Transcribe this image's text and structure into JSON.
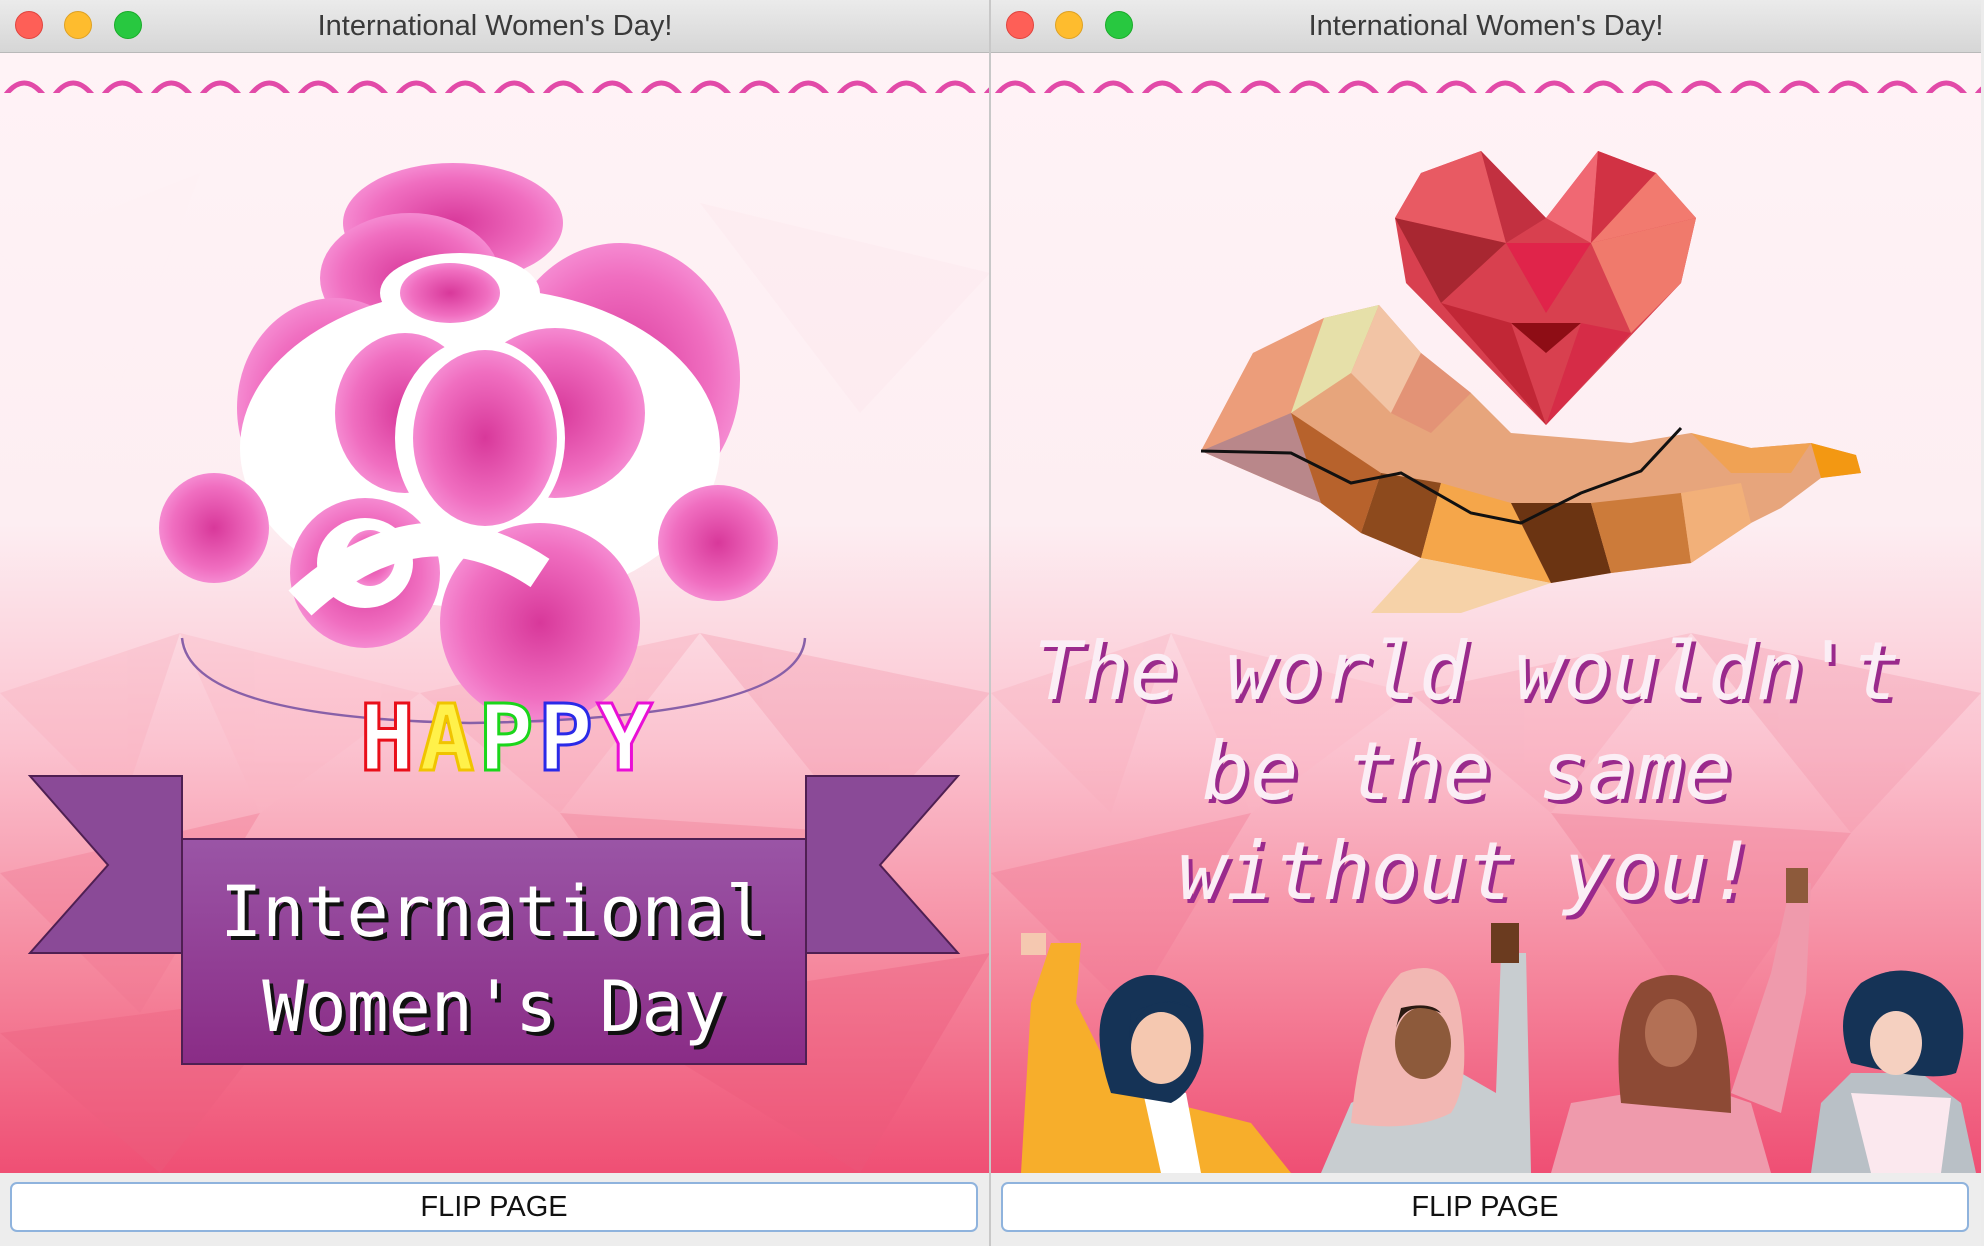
{
  "left_window": {
    "title": "International Women's Day!",
    "card": {
      "happy_word": "HAPPY",
      "banner_line1": "International",
      "banner_line2": "Women's Day"
    },
    "button_label": "FLIP PAGE"
  },
  "right_window": {
    "title": "International Women's Day!",
    "card": {
      "message_line1": "The world wouldn't",
      "message_line2": "be the same",
      "message_line3": "without you!"
    },
    "button_label": "FLIP PAGE"
  },
  "colors": {
    "card_top": "#fff5f7",
    "card_bottom": "#f05577",
    "rose_pink": "#f06ec0",
    "ribbon_purple": "#8f4a9c",
    "message_text": "#8e1a86",
    "button_border": "#8fb3dd"
  },
  "icons": [
    "rose-icon",
    "heart-icon",
    "hand-icon",
    "scallop-border"
  ]
}
